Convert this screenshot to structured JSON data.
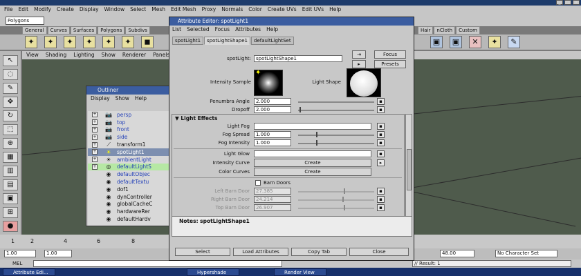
{
  "main": {
    "menu": [
      "File",
      "Edit",
      "Modify",
      "Create",
      "Display",
      "Window",
      "Select",
      "Mesh",
      "Edit Mesh",
      "Proxy",
      "Normals",
      "Color",
      "Create UVs",
      "Edit UVs",
      "Help"
    ],
    "mode": "Polygons",
    "shelf_tabs": [
      "General",
      "Curves",
      "Surfaces",
      "Polygons",
      "Subdivs"
    ],
    "shelf_tabs_right": [
      "Hair",
      "nCloth",
      "Custom"
    ],
    "panel_menu": [
      "View",
      "Shading",
      "Lighting",
      "Show",
      "Renderer",
      "Panels"
    ]
  },
  "outliner": {
    "title": "Outliner",
    "menu": [
      "Display",
      "Show",
      "Help"
    ],
    "items": [
      {
        "label": "persp",
        "icon": "📷"
      },
      {
        "label": "top",
        "icon": "📷"
      },
      {
        "label": "front",
        "icon": "📷"
      },
      {
        "label": "side",
        "icon": "📷"
      },
      {
        "label": "transform1",
        "icon": "⟋"
      },
      {
        "label": "spotLight1",
        "icon": "☀"
      },
      {
        "label": "ambientLight",
        "icon": "☀"
      },
      {
        "label": "defaultLightS",
        "icon": "◎"
      },
      {
        "label": "defaultObjec",
        "icon": "◉"
      },
      {
        "label": "defaultTextu",
        "icon": "◉"
      },
      {
        "label": "dof1",
        "icon": "◉"
      },
      {
        "label": "dynController",
        "icon": "◉"
      },
      {
        "label": "globalCacheC",
        "icon": "◉"
      },
      {
        "label": "hardwareRer",
        "icon": "◉"
      },
      {
        "label": "defaultHardv",
        "icon": "◉"
      }
    ]
  },
  "ae": {
    "title": "Attribute Editor: spotLight1",
    "menu": [
      "List",
      "Selected",
      "Focus",
      "Attributes",
      "Help"
    ],
    "tabs": [
      "spotLight1",
      "spotLightShape1",
      "defaultLightSet"
    ],
    "node_label": "spotLight:",
    "node_value": "spotLightShape1",
    "focus": "Focus",
    "presets": "Presets",
    "intensity_sample": "Intensity Sample",
    "light_shape": "Light Shape",
    "penumbra_label": "Penumbra Angle",
    "penumbra_value": "2.000",
    "dropoff_label": "Dropoff",
    "dropoff_value": "2.000",
    "section_light_effects": "Light Effects",
    "light_fog": "Light Fog",
    "fog_spread_label": "Fog Spread",
    "fog_spread_value": "1.000",
    "fog_intensity_label": "Fog Intensity",
    "fog_intensity_value": "1.000",
    "light_glow": "Light Glow",
    "intensity_curve": "Intensity Curve",
    "color_curves": "Color Curves",
    "create": "Create",
    "barn_doors": "Barn Doors",
    "left_barn_label": "Left Barn Door",
    "left_barn_value": "27.385",
    "right_barn_label": "Right Barn Door",
    "right_barn_value": "24.214",
    "top_barn_label": "Top Barn Door",
    "top_barn_value": "26.907",
    "notes_label": "Notes:  spotLightShape1",
    "buttons": [
      "Select",
      "Load Attributes",
      "Copy Tab",
      "Close"
    ]
  },
  "timeline": {
    "ticks": [
      "1",
      "2",
      "4",
      "6",
      "8"
    ],
    "start": "1.00",
    "start2": "1.00",
    "end": "48.00",
    "char_set": "No Character Set",
    "mel": "MEL",
    "result": "// Result: 1"
  },
  "taskbar": [
    "Attribute Edi...",
    "Hypershade",
    "Render View"
  ]
}
